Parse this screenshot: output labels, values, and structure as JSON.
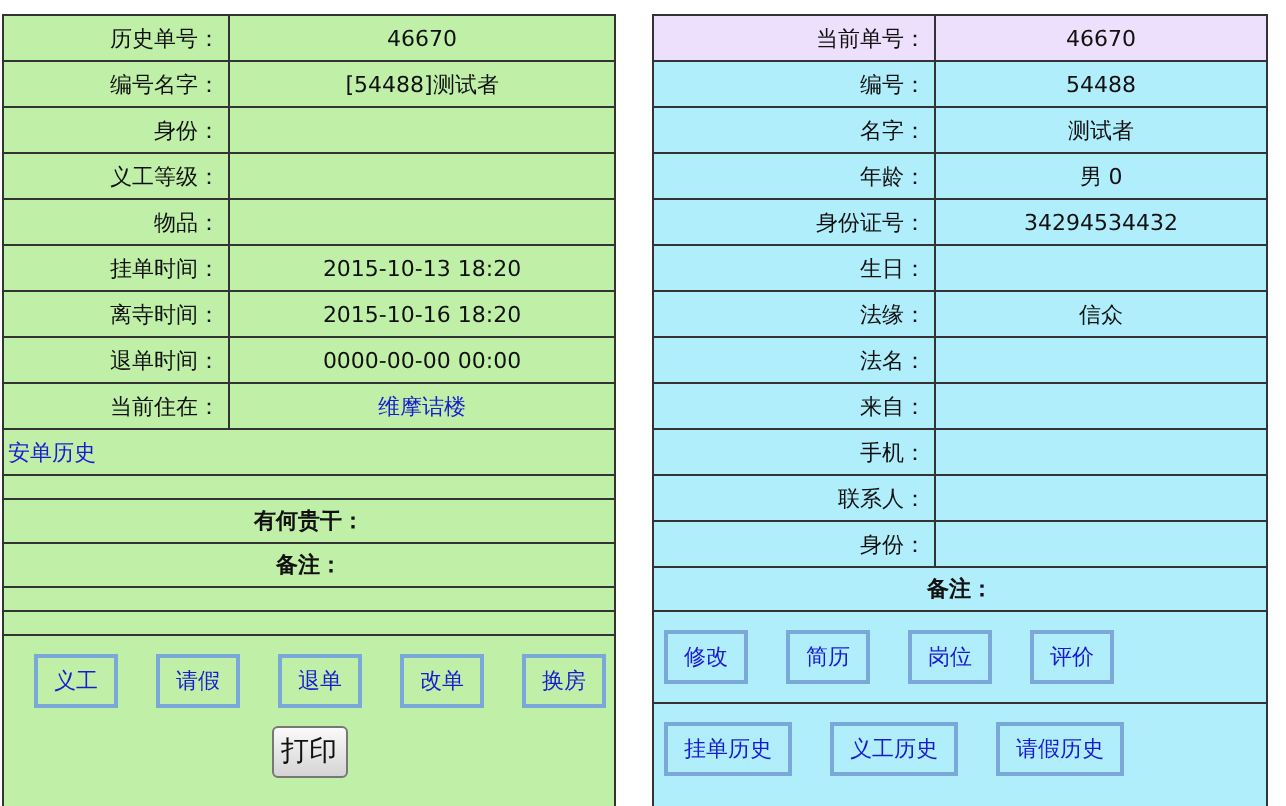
{
  "history_panel": {
    "fields": [
      {
        "label": "历史单号：",
        "value": "46670",
        "kind": "text"
      },
      {
        "label": "编号名字：",
        "value": "[54488]测试者",
        "kind": "text"
      },
      {
        "label": "身份：",
        "kind": "text"
      },
      {
        "label": "义工等级：",
        "kind": "text"
      },
      {
        "label": "物品：",
        "kind": "text"
      },
      {
        "label": "挂单时间：",
        "value": "2015-10-13 18:20",
        "kind": "text"
      },
      {
        "label": "离寺时间：",
        "value": "2015-10-16 18:20",
        "kind": "text"
      },
      {
        "label": "退单时间：",
        "value": "0000-00-00 00:00",
        "kind": "text"
      },
      {
        "label": "当前住在：",
        "value": "维摩诘楼",
        "kind": "link"
      }
    ],
    "history_link": "安单历史",
    "inquiry_label": "有何贵干：",
    "remarks_label": "备注：",
    "buttons": [
      "义工",
      "请假",
      "退单",
      "改单",
      "换房"
    ],
    "print_button": "打印"
  },
  "person_panel": {
    "fields": [
      {
        "label": "当前单号：",
        "value": "46670",
        "highlighted": true
      },
      {
        "label": "编号：",
        "value": "54488",
        "highlighted": false
      },
      {
        "label": "名字：",
        "value": "测试者",
        "highlighted": false
      },
      {
        "label": "年龄：",
        "value": "男 0",
        "highlighted": false
      },
      {
        "label": "身份证号：",
        "value": "34294534432",
        "highlighted": false
      },
      {
        "label": "生日：",
        "highlighted": false
      },
      {
        "label": "法缘：",
        "value": "信众",
        "highlighted": false
      },
      {
        "label": "法名：",
        "highlighted": false
      },
      {
        "label": "来自：",
        "highlighted": false
      },
      {
        "label": "手机：",
        "highlighted": false
      },
      {
        "label": "联系人：",
        "highlighted": false
      },
      {
        "label": "身份：",
        "highlighted": false
      }
    ],
    "remarks_label": "备注：",
    "action_buttons": [
      "修改",
      "简历",
      "岗位",
      "评价"
    ],
    "history_buttons": [
      "挂单历史",
      "义工历史",
      "请假历史"
    ]
  }
}
